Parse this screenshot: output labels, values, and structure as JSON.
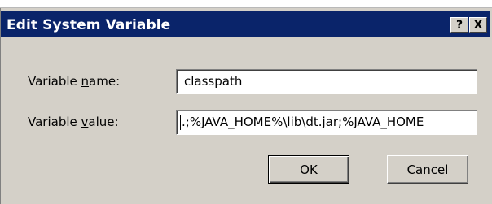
{
  "dialog": {
    "title": "Edit System Variable",
    "help_label": "?",
    "close_label": "X"
  },
  "form": {
    "name_label_pre": "Variable ",
    "name_label_accel": "n",
    "name_label_post": "ame:",
    "name_value": "classpath",
    "value_label_pre": "Variable ",
    "value_label_accel": "v",
    "value_label_post": "alue:",
    "value_value": ".;%JAVA_HOME%\\lib\\dt.jar;%JAVA_HOME"
  },
  "buttons": {
    "ok_label": "OK",
    "cancel_label": "Cancel"
  }
}
